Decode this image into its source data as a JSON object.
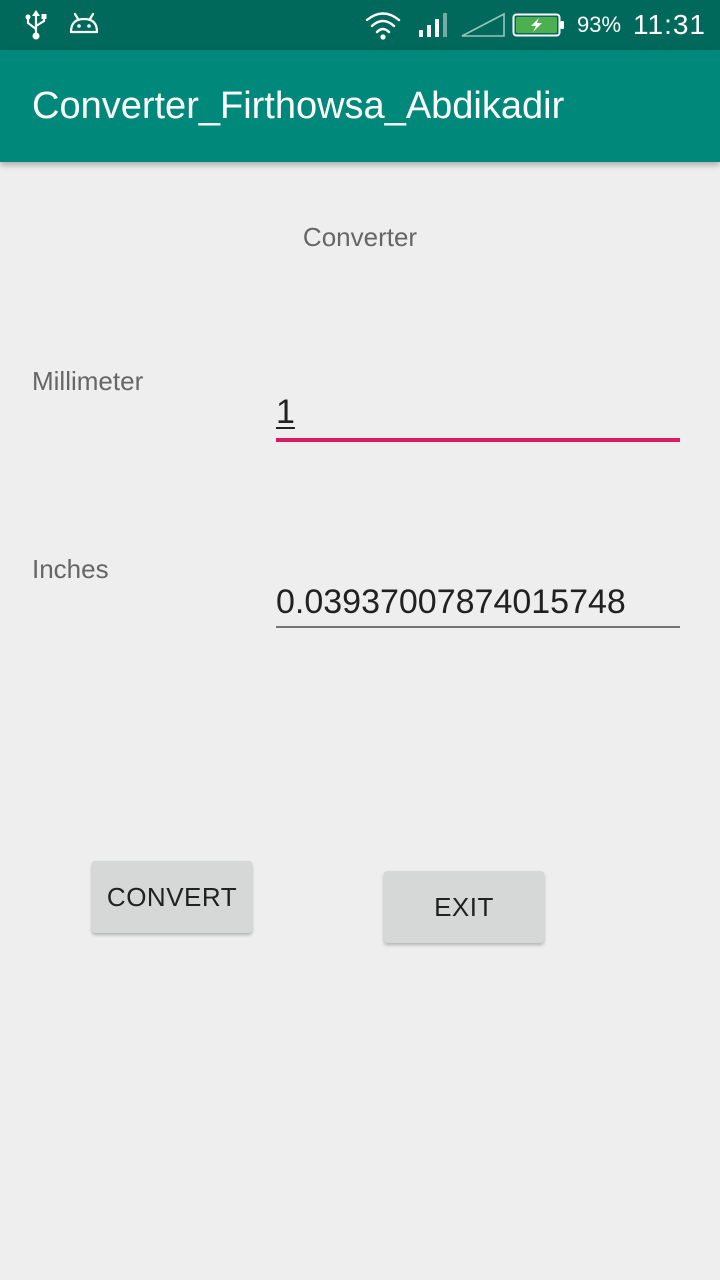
{
  "status_bar": {
    "icons": [
      "usb-icon",
      "android-debug-icon",
      "wifi-icon",
      "signal-icon",
      "no-signal-icon",
      "battery-charging-icon"
    ],
    "battery_percent": "93%",
    "time": "11:31",
    "colors": {
      "background": "#00695c",
      "battery_fill": "#4caf50"
    }
  },
  "app_bar": {
    "title": "Converter_Firthowsa_Abdikadir",
    "color": "#00897b"
  },
  "main": {
    "heading": "Converter",
    "millimeter": {
      "label": "Millimeter",
      "value": "1"
    },
    "inches": {
      "label": "Inches",
      "value": "0.03937007874015748"
    },
    "buttons": {
      "convert": "CONVERT",
      "exit": "EXIT"
    },
    "colors": {
      "focused_underline": "#d81b60",
      "background": "#eeeeee"
    }
  }
}
